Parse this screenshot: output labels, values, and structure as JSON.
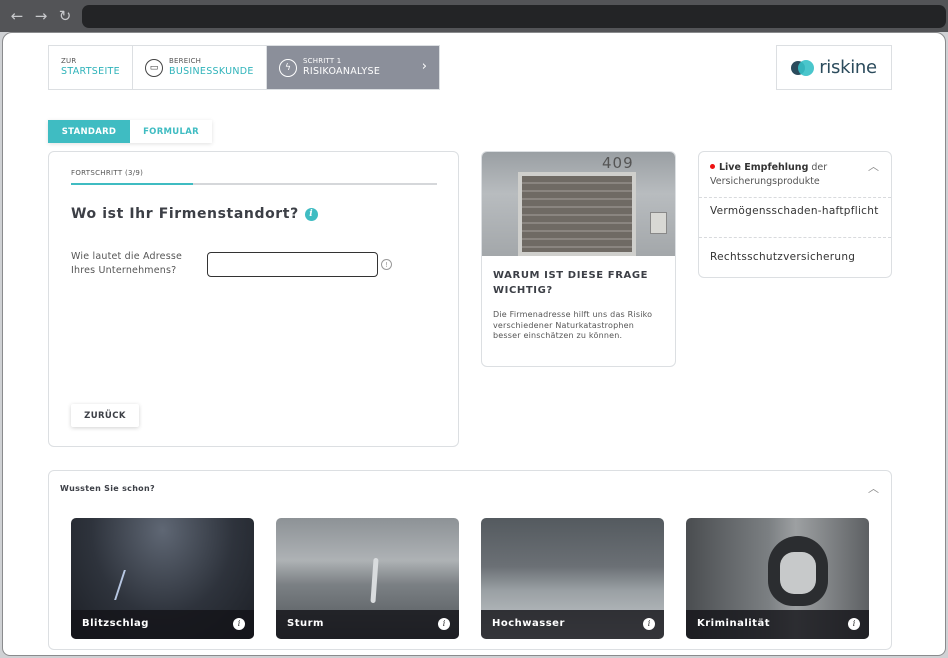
{
  "browser": {
    "back_icon": "arrow-left-icon",
    "forward_icon": "arrow-right-icon",
    "reload_icon": "reload-icon"
  },
  "breadcrumb": [
    {
      "small": "ZUR",
      "large": "STARTSEITE"
    },
    {
      "small": "BEREICH",
      "large": "BUSINESSKUNDE",
      "icon": "briefcase-icon"
    },
    {
      "small": "SCHRITT 1",
      "large": "RISIKOANALYSE",
      "icon": "lightning-icon"
    }
  ],
  "logo": {
    "text": "riskine"
  },
  "modes": {
    "standard": "STANDARD",
    "formular": "FORMULAR"
  },
  "question": {
    "progress_label": "FORTSCHRITT  (3/9)",
    "progress_fraction": 0.333,
    "title": "Wo ist Ihr Firmenstandort?",
    "field_label": "Wie lautet die Adresse Ihres Unternehmens?",
    "field_value": "",
    "back_label": "ZURÜCK"
  },
  "why": {
    "image_number": "409",
    "title": "WARUM IST DIESE FRAGE WICHTIG?",
    "text": "Die Firmenadresse hilft uns das Risiko verschiedener Naturkatastrophen besser einschätzen zu können."
  },
  "live": {
    "bold": "Live Empfehlung",
    "rest": " der Versicherungsprodukte",
    "items": [
      "Vermögensschaden-haftpflicht",
      "Rechtsschutzversicherung"
    ]
  },
  "did_you_know": {
    "title": "Wussten Sie schon?",
    "tiles": [
      "Blitzschlag",
      "Sturm",
      "Hochwasser",
      "Kriminalität"
    ]
  },
  "colors": {
    "accent": "#3fbcc2",
    "active_step": "#8b8f9a",
    "live_dot": "#e11111"
  }
}
